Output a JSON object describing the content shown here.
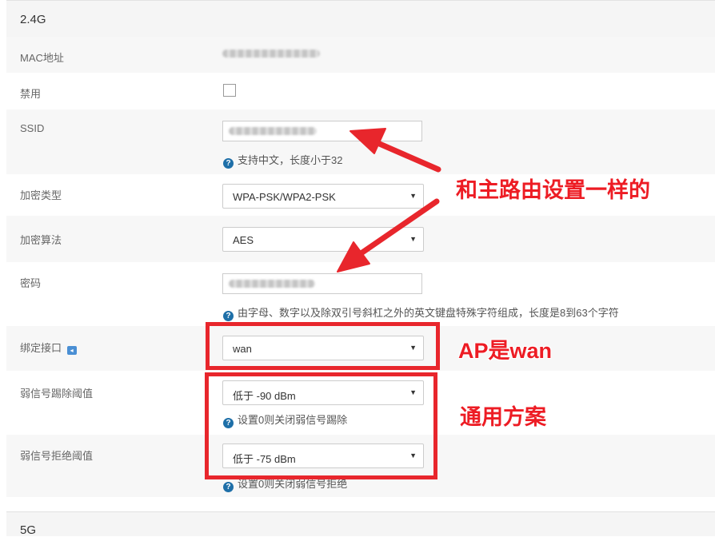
{
  "section_24g": {
    "title": "2.4G"
  },
  "section_5g": {
    "title": "5G"
  },
  "fields": {
    "mac": {
      "label": "MAC地址"
    },
    "disable": {
      "label": "禁用"
    },
    "ssid": {
      "label": "SSID",
      "help": "支持中文，长度小于32"
    },
    "enc_type": {
      "label": "加密类型",
      "value": "WPA-PSK/WPA2-PSK"
    },
    "enc_alg": {
      "label": "加密算法",
      "value": "AES"
    },
    "password": {
      "label": "密码",
      "help": "由字母、数字以及除双引号斜杠之外的英文键盘特殊字符组成，长度是8到63个字符"
    },
    "bind_iface": {
      "label": "绑定接口",
      "value": "wan"
    },
    "weak_kick": {
      "label": "弱信号踢除阈值",
      "value": "低于 -90 dBm",
      "help": "设置0则关闭弱信号踢除"
    },
    "weak_reject": {
      "label": "弱信号拒绝阈值",
      "value": "低于 -75 dBm",
      "help": "设置0则关闭弱信号拒绝"
    }
  },
  "annotations": {
    "same_as_main": "和主路由设置一样的",
    "ap_wan": "AP是wan",
    "general": "通用方案"
  },
  "colors": {
    "annotation_red": "#ed1c24",
    "help_icon": "#1e6fa8"
  }
}
